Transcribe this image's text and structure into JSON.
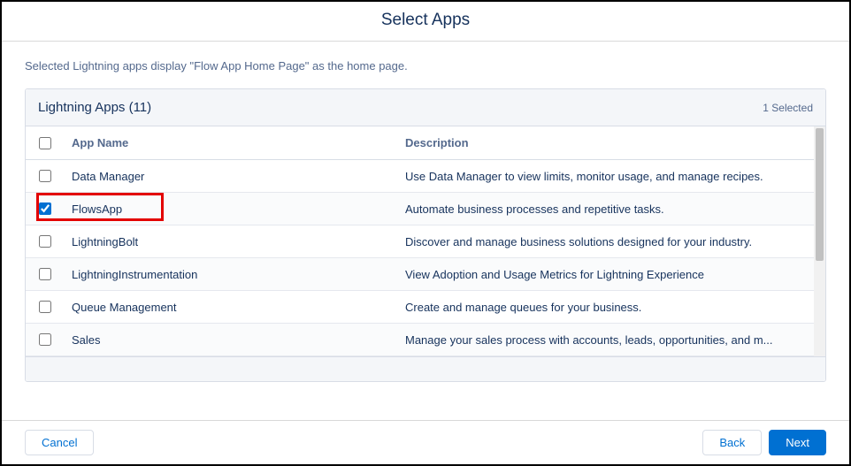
{
  "title": "Select Apps",
  "subtitle": "Selected Lightning apps display \"Flow App Home Page\" as the home page.",
  "card": {
    "title": "Lightning Apps (11)",
    "selected_text": "1 Selected"
  },
  "columns": {
    "name": "App Name",
    "description": "Description"
  },
  "rows": [
    {
      "checked": false,
      "name": "Data Manager",
      "description": "Use Data Manager to view limits, monitor usage, and manage recipes."
    },
    {
      "checked": true,
      "name": "FlowsApp",
      "description": "Automate business processes and repetitive tasks."
    },
    {
      "checked": false,
      "name": "LightningBolt",
      "description": "Discover and manage business solutions designed for your industry."
    },
    {
      "checked": false,
      "name": "LightningInstrumentation",
      "description": "View Adoption and Usage Metrics for Lightning Experience"
    },
    {
      "checked": false,
      "name": "Queue Management",
      "description": "Create and manage queues for your business."
    },
    {
      "checked": false,
      "name": "Sales",
      "description": "Manage your sales process with accounts, leads, opportunities, and m..."
    }
  ],
  "footer": {
    "cancel": "Cancel",
    "back": "Back",
    "next": "Next"
  }
}
